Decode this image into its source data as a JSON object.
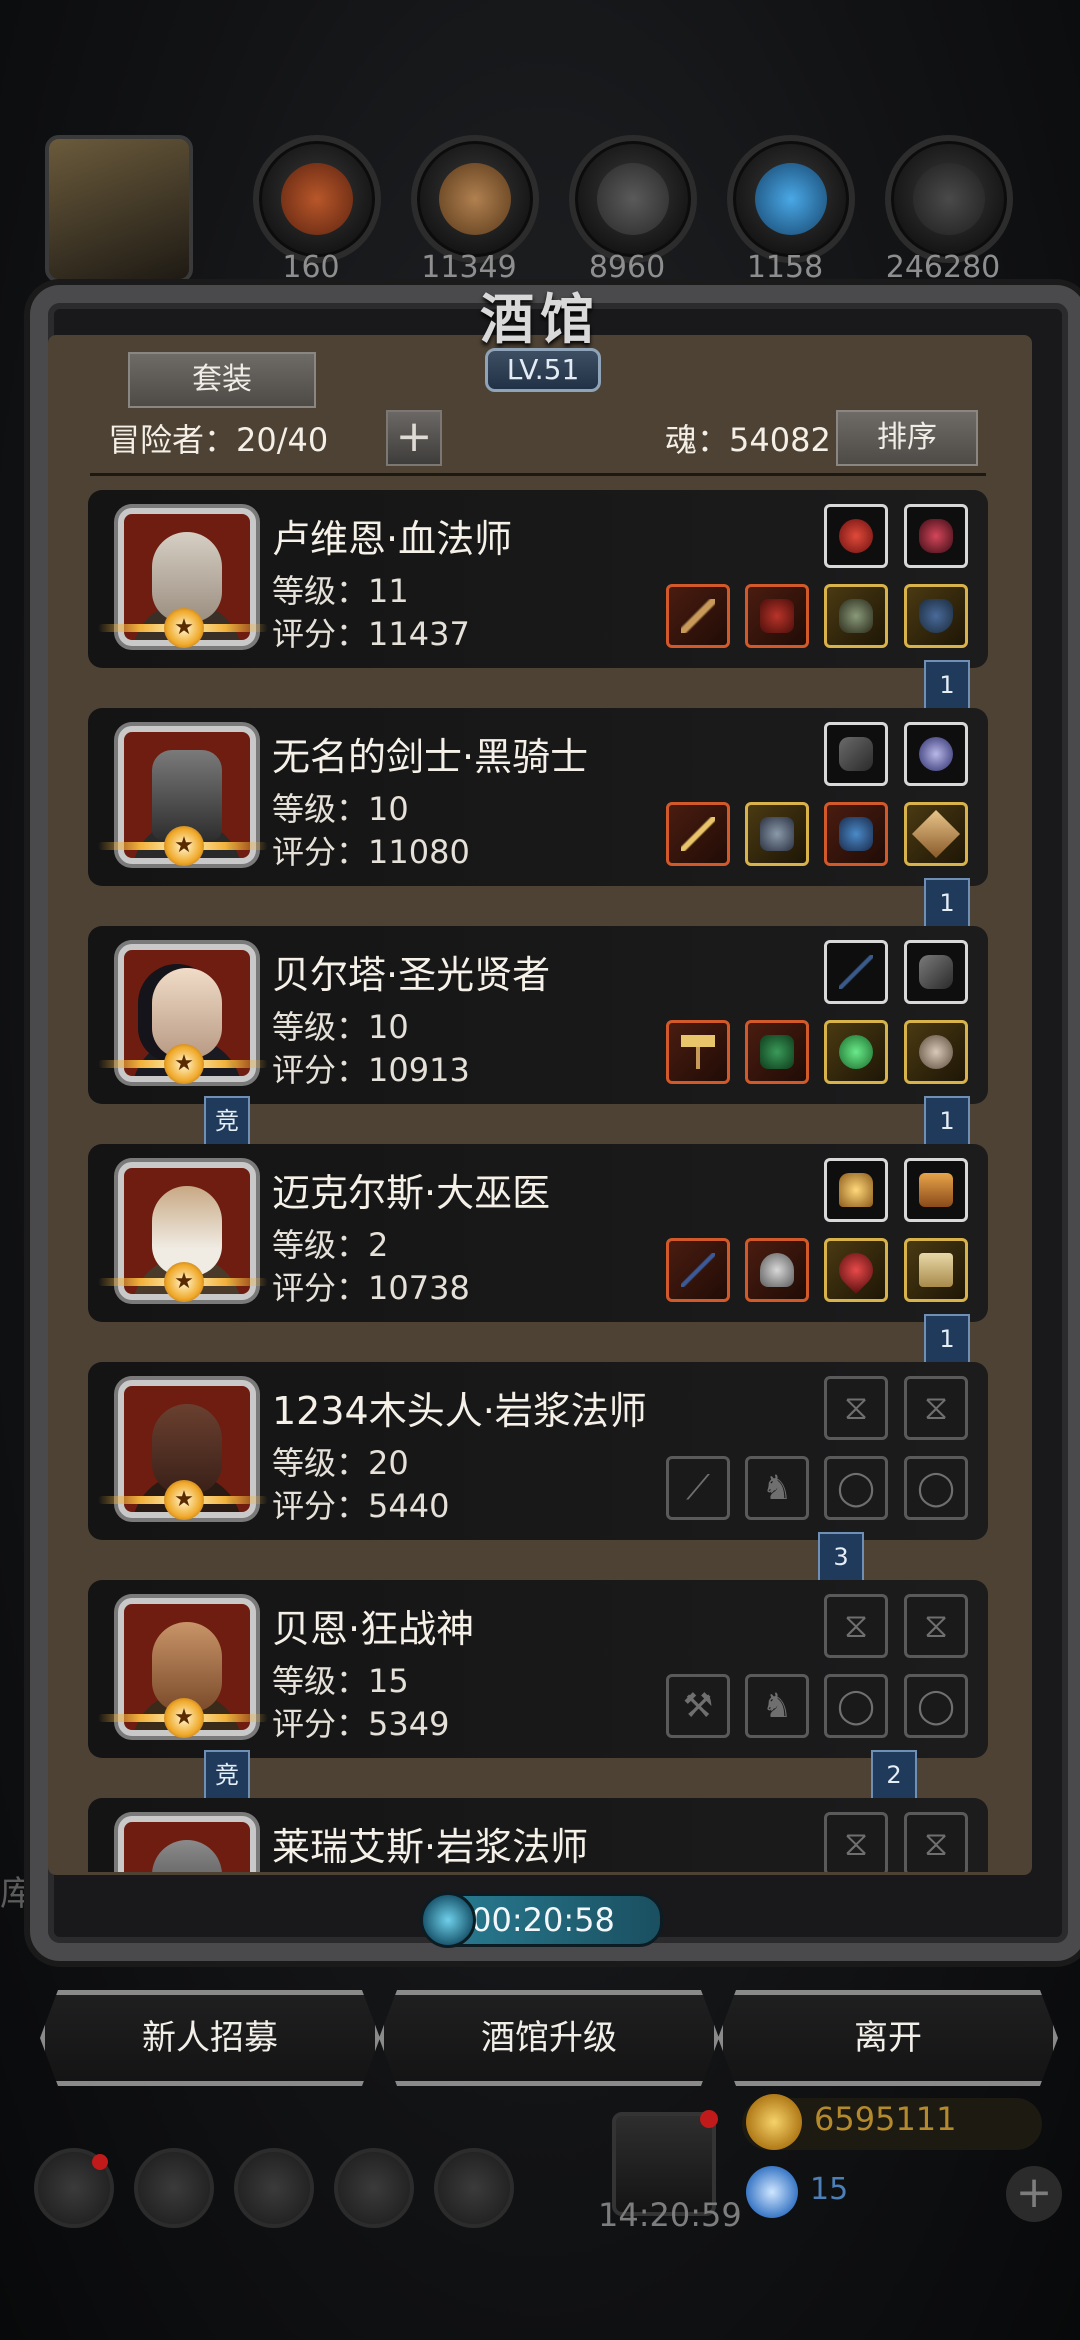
{
  "top_resources": {
    "values": [
      "160",
      "11349",
      "8960",
      "1158",
      "246280"
    ]
  },
  "tavern": {
    "title": "酒馆",
    "level": "LV.51",
    "set_button": "套装",
    "adventurers_label": "冒险者：20/40",
    "plus_icon": "+",
    "soul_label": "魂：54082",
    "sort_button": "排序"
  },
  "adventurers": [
    {
      "name": "卢维恩·血法师",
      "level": "等级：11",
      "score": "评分：11437",
      "flag_right": "1",
      "flag_left": ""
    },
    {
      "name": "无名的剑士·黑骑士",
      "level": "等级：10",
      "score": "评分：11080",
      "flag_right": "1",
      "flag_left": ""
    },
    {
      "name": "贝尔塔·圣光贤者",
      "level": "等级：10",
      "score": "评分：10913",
      "flag_right": "1",
      "flag_left": "竞"
    },
    {
      "name": "迈克尔斯·大巫医",
      "level": "等级：2",
      "score": "评分：10738",
      "flag_right": "1",
      "flag_left": ""
    },
    {
      "name": "1234木头人·岩浆法师",
      "level": "等级：20",
      "score": "评分：5440",
      "flag_right": "3",
      "flag_left": ""
    },
    {
      "name": "贝恩·狂战神",
      "level": "等级：15",
      "score": "评分：5349",
      "flag_right": "2",
      "flag_left": "竞"
    },
    {
      "name": "莱瑞艾斯·岩浆法师",
      "level": "",
      "score": "",
      "flag_right": "",
      "flag_left": ""
    }
  ],
  "timer": "00:20:58",
  "bottom_buttons": {
    "recruit": "新人招募",
    "upgrade": "酒馆升级",
    "leave": "离开"
  },
  "hud": {
    "gift_time": "14:20:59",
    "gold": "6595111",
    "gems": "15",
    "side_text": "库"
  },
  "colors": {
    "accent_gold": "#f2b23c",
    "panel_bg": "#4d4233",
    "timer_teal": "#2a7f96"
  }
}
